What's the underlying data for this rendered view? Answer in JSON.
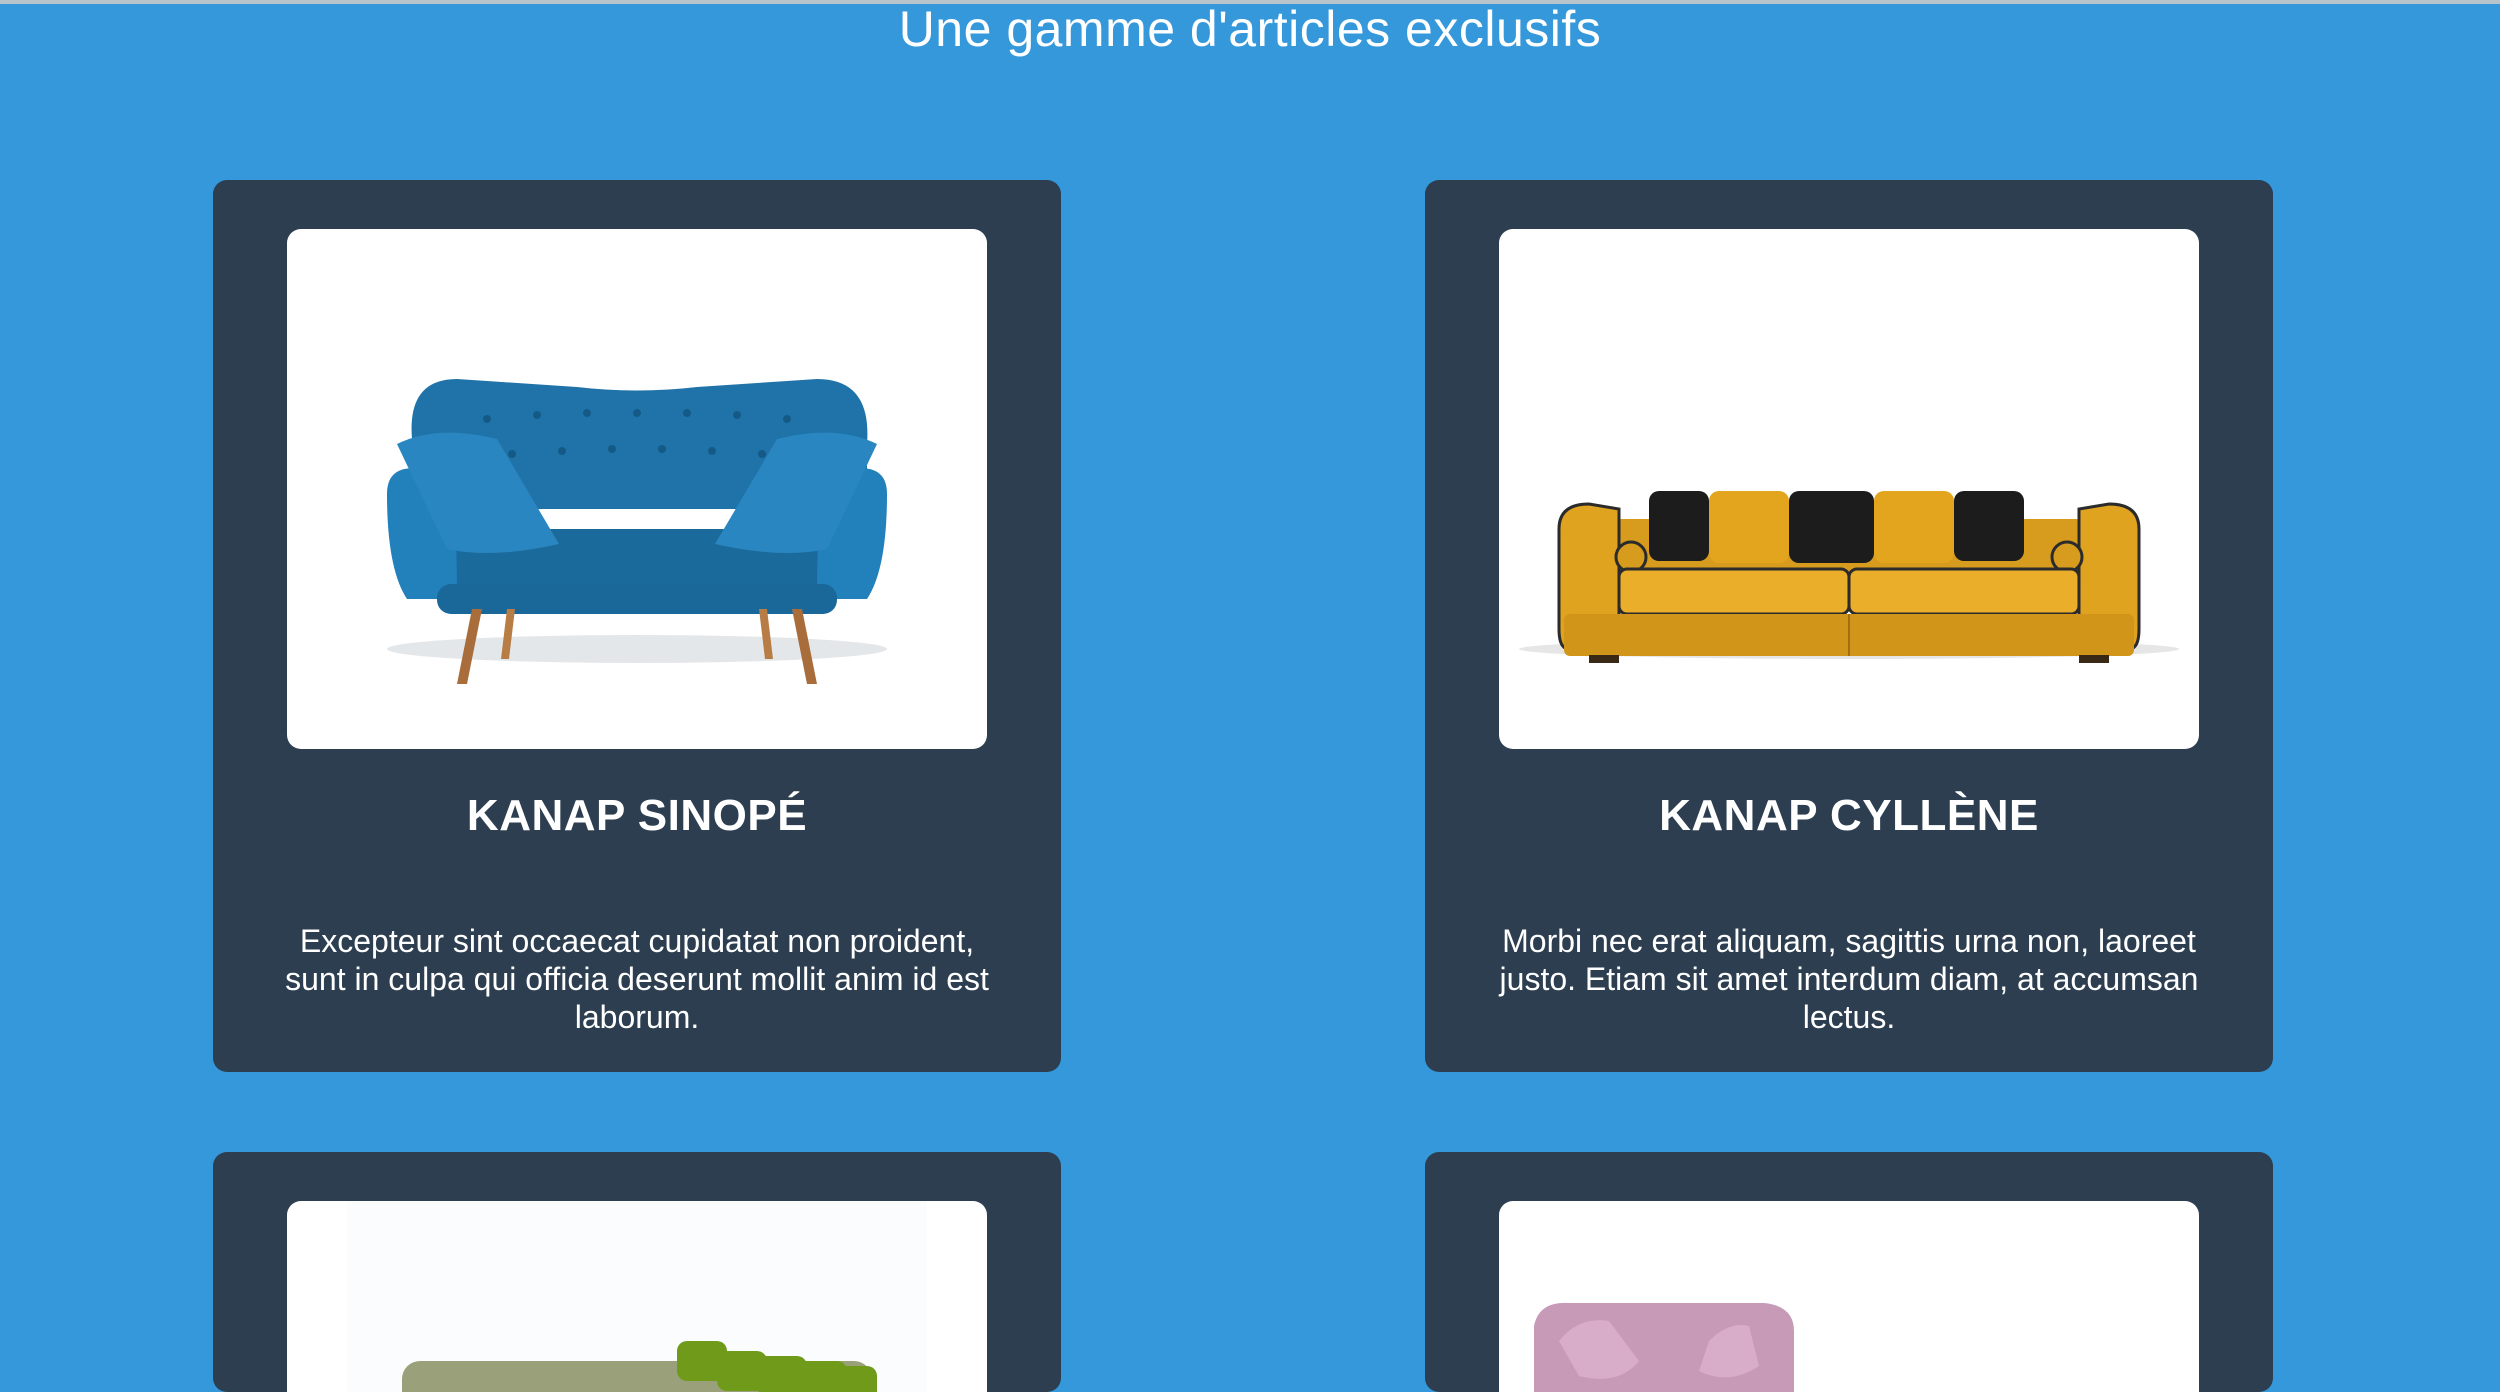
{
  "page": {
    "title": "Une gamme d'articles exclusifs"
  },
  "colors": {
    "background": "#3498db",
    "card": "#2c3e50",
    "image_frame": "#ffffff",
    "text": "#ffffff"
  },
  "products": [
    {
      "name": "KANAP SINOPÉ",
      "description": "Excepteur sint occaecat cupidatat non proident, sunt in culpa qui officia deserunt mollit anim id est laborum.",
      "image_icon": "blue-sofa-image"
    },
    {
      "name": "KANAP CYLLÈNE",
      "description": "Morbi nec erat aliquam, sagittis urna non, laoreet justo. Etiam sit amet interdum diam, at accumsan lectus.",
      "image_icon": "yellow-sofa-image"
    },
    {
      "name": "",
      "description": "",
      "image_icon": "green-sofa-image"
    },
    {
      "name": "",
      "description": "",
      "image_icon": "pink-sofa-image"
    }
  ]
}
